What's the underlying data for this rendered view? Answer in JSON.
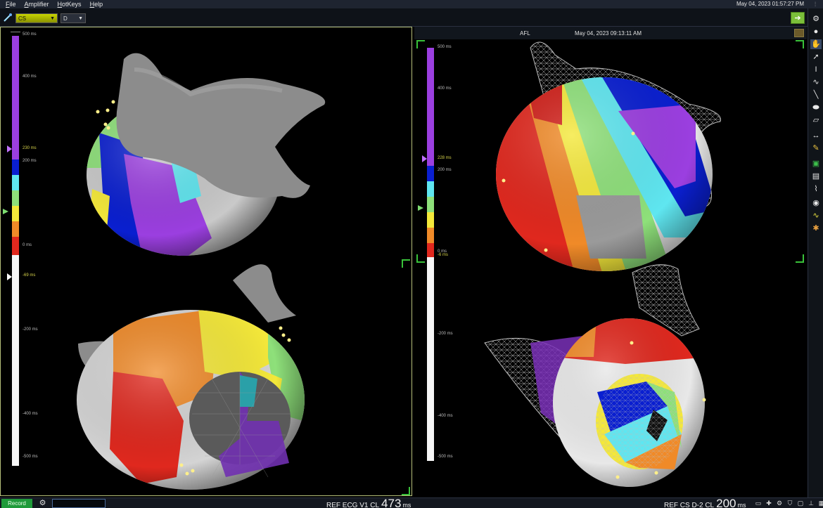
{
  "menu": [
    {
      "pre": "",
      "ul": "F",
      "post": "ile"
    },
    {
      "pre": "",
      "ul": "A",
      "post": "mplifier"
    },
    {
      "pre": "",
      "ul": "H",
      "post": "otKeys"
    },
    {
      "pre": "",
      "ul": "H",
      "post": "elp"
    }
  ],
  "clock": "May 04, 2023 01:57:27 PM",
  "toolbar": {
    "catheter_select": "CS",
    "electrode_select": "D"
  },
  "left_map": {
    "scale_labels": {
      "top": "500 ms",
      "l400": "400 ms",
      "marker_upper": "230 ms",
      "l200": "200 ms",
      "l0": "0 ms",
      "marker_lower": "-69 ms",
      "lm200": "-200 ms",
      "lm400": "-400 ms",
      "bottom": "-500 ms"
    }
  },
  "right_map": {
    "title": "AFL",
    "timestamp": "May 04, 2023 09:13:11 AM",
    "scale_labels": {
      "top": "500 ms",
      "l400": "400 ms",
      "marker_upper": "228 ms",
      "l200": "200 ms",
      "l0": "0 ms",
      "marker_lower": "-6 ms",
      "lm200": "-200 ms",
      "lm400": "-400 ms",
      "bottom": "-500 ms"
    }
  },
  "colors": {
    "purple": "#9b3fe0",
    "blue": "#0a1fd0",
    "cyan": "#5fe6f0",
    "green": "#8ee07a",
    "yellow": "#f4e83a",
    "orange": "#f08a28",
    "red": "#e0281e",
    "accent_green": "#39c23a"
  },
  "statusbar": {
    "record_label": "Record",
    "left_ref": {
      "label": "REF ECG V1 CL",
      "value": "473",
      "unit": "ms"
    },
    "right_ref": {
      "label": "REF CS  D-2 CL",
      "value": "200",
      "unit": "ms"
    }
  }
}
